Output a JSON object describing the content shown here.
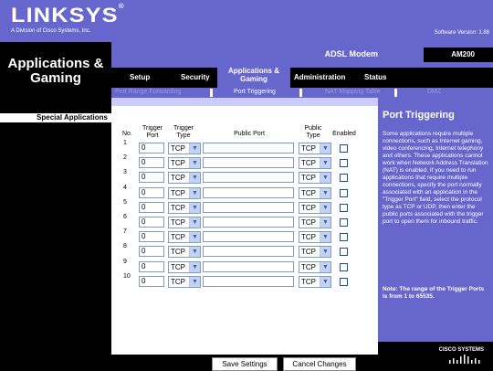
{
  "header": {
    "brand": "LINKSYS",
    "brand_tagline": "A Division of Cisco Systems, Inc.",
    "firmware": "Software Version: 1.88"
  },
  "section_title": "Applications & Gaming",
  "model": {
    "name": "ADSL Modem",
    "id": "AM200"
  },
  "tabs": [
    {
      "label": "Setup"
    },
    {
      "label": "Security"
    },
    {
      "label": "Applications & Gaming"
    },
    {
      "label": "Administration"
    },
    {
      "label": "Status"
    }
  ],
  "subtabs": [
    {
      "label": "Port Range Forwarding"
    },
    {
      "label": "Port Triggering"
    },
    {
      "label": "NAT Mapping Table"
    },
    {
      "label": "DMZ"
    }
  ],
  "left_heading": "Special Applications",
  "table": {
    "headers": {
      "no": "No.",
      "trigger_port": "Trigger Port",
      "trigger_type": "Trigger Type",
      "public_port": "Public Port",
      "public_type": "Public Type",
      "enabled": "Enabled"
    },
    "rows": [
      {
        "no": "1",
        "trigger_port": "0",
        "trigger_type": "TCP",
        "public_port": "",
        "public_type": "TCP",
        "enabled": false
      },
      {
        "no": "2",
        "trigger_port": "0",
        "trigger_type": "TCP",
        "public_port": "",
        "public_type": "TCP",
        "enabled": false
      },
      {
        "no": "3",
        "trigger_port": "0",
        "trigger_type": "TCP",
        "public_port": "",
        "public_type": "TCP",
        "enabled": false
      },
      {
        "no": "4",
        "trigger_port": "0",
        "trigger_type": "TCP",
        "public_port": "",
        "public_type": "TCP",
        "enabled": false
      },
      {
        "no": "5",
        "trigger_port": "0",
        "trigger_type": "TCP",
        "public_port": "",
        "public_type": "TCP",
        "enabled": false
      },
      {
        "no": "6",
        "trigger_port": "0",
        "trigger_type": "TCP",
        "public_port": "",
        "public_type": "TCP",
        "enabled": false
      },
      {
        "no": "7",
        "trigger_port": "0",
        "trigger_type": "TCP",
        "public_port": "",
        "public_type": "TCP",
        "enabled": false
      },
      {
        "no": "8",
        "trigger_port": "0",
        "trigger_type": "TCP",
        "public_port": "",
        "public_type": "TCP",
        "enabled": false
      },
      {
        "no": "9",
        "trigger_port": "0",
        "trigger_type": "TCP",
        "public_port": "",
        "public_type": "TCP",
        "enabled": false
      },
      {
        "no": "10",
        "trigger_port": "0",
        "trigger_type": "TCP",
        "public_port": "",
        "public_type": "TCP",
        "enabled": false
      }
    ]
  },
  "help": {
    "title": "Port Triggering",
    "body": "Some applications require multiple connections, such as Internet gaming, video conferencing, Internet telephony and others. These applications cannot work when Network Address Translation (NAT) is enabled. If you need to run applications that require multiple connections, specify the port normally associated with an application in the \"Trigger Port\" field, select the protocol type as TCP or UDP, then enter the public ports associated with the trigger port to open them for inbound traffic.",
    "note": "Note: The range of the Trigger Ports is from 1 to 65535."
  },
  "buttons": {
    "save": "Save Settings",
    "cancel": "Cancel Changes"
  },
  "cisco_logo": "CISCO SYSTEMS",
  "icons": {
    "dropdown": "chevron-down-icon",
    "checkbox": "checkbox-icon",
    "cisco": "cisco-bridge-logo"
  },
  "colors": {
    "brand": "#6666cc",
    "background": "#000000",
    "light": "#ccccff"
  }
}
